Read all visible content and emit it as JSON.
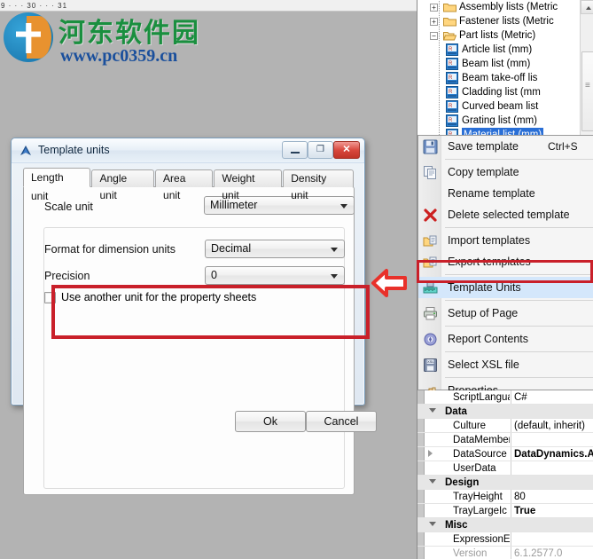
{
  "ruler": {
    "ticks": "9 · · · 30 · · · 31"
  },
  "watermark": {
    "cn_text": "河东软件园",
    "url": "www.pc0359.cn",
    "logo_icon": "circle-logo-icon"
  },
  "dialog": {
    "title": "Template units",
    "icon": "blue-triangle-icon",
    "window_buttons": {
      "minimize": "—",
      "maximize": "❐",
      "close": "✕"
    },
    "tabs": [
      {
        "label": "Length unit",
        "active": true
      },
      {
        "label": "Angle unit",
        "active": false
      },
      {
        "label": "Area unit",
        "active": false
      },
      {
        "label": "Weight unit",
        "active": false
      },
      {
        "label": "Density unit",
        "active": false
      }
    ],
    "scale_unit": {
      "label": "Scale unit",
      "value": "Millimeter"
    },
    "format_units": {
      "label": "Format for dimension units",
      "value": "Decimal"
    },
    "precision": {
      "label": "Precision",
      "value": "0"
    },
    "checkbox": {
      "label": "Use another unit for the property sheets",
      "checked": false
    },
    "buttons": {
      "ok": "Ok",
      "cancel": "Cancel"
    },
    "highlight_color": "#c9202a"
  },
  "annotation": {
    "arrow_icon": "red-left-arrow-icon",
    "color": "#e8312a"
  },
  "tree": {
    "nodes": [
      {
        "label": "Assembly lists (Metric",
        "icon": "folder-icon",
        "expander": "+",
        "depth": 0,
        "selected": false
      },
      {
        "label": "Fastener lists (Metric",
        "icon": "folder-icon",
        "expander": "+",
        "depth": 0,
        "selected": false
      },
      {
        "label": "Part lists (Metric)",
        "icon": "folder-open-icon",
        "expander": "−",
        "depth": 0,
        "selected": false
      },
      {
        "label": "Article list (mm)",
        "icon": "report-icon",
        "expander": "",
        "depth": 1,
        "selected": false
      },
      {
        "label": "Beam list (mm)",
        "icon": "report-icon",
        "expander": "",
        "depth": 1,
        "selected": false
      },
      {
        "label": "Beam take-off lis",
        "icon": "report-icon",
        "expander": "",
        "depth": 1,
        "selected": false
      },
      {
        "label": "Cladding list (mm",
        "icon": "report-icon",
        "expander": "",
        "depth": 1,
        "selected": false
      },
      {
        "label": "Curved beam list",
        "icon": "report-icon",
        "expander": "",
        "depth": 1,
        "selected": false
      },
      {
        "label": "Grating list (mm)",
        "icon": "report-icon",
        "expander": "",
        "depth": 1,
        "selected": false
      },
      {
        "label": "Material list (mm)",
        "icon": "report-icon",
        "expander": "",
        "depth": 1,
        "selected": true
      }
    ],
    "scrollbar": {
      "up_arrow": "▲",
      "thumb_grip": "≡"
    }
  },
  "context_menu": {
    "items": [
      {
        "label": "Save template",
        "accel": "Ctrl+S",
        "icon": "save-icon",
        "selected": false,
        "sep_after": true
      },
      {
        "label": "Copy template",
        "accel": "",
        "icon": "copy-icon",
        "selected": false,
        "sep_after": false
      },
      {
        "label": "Rename template",
        "accel": "",
        "icon": "",
        "selected": false,
        "sep_after": false
      },
      {
        "label": "Delete selected template",
        "accel": "",
        "icon": "delete-icon",
        "selected": false,
        "sep_after": true
      },
      {
        "label": "Import templates",
        "accel": "",
        "icon": "import-icon",
        "selected": false,
        "sep_after": false
      },
      {
        "label": "Export templates",
        "accel": "",
        "icon": "export-icon",
        "selected": false,
        "sep_after": true
      },
      {
        "label": "Template Units",
        "accel": "",
        "icon": "ruler-icon",
        "selected": true,
        "sep_after": true
      },
      {
        "label": "Setup of Page",
        "accel": "",
        "icon": "printer-icon",
        "selected": false,
        "sep_after": true
      },
      {
        "label": "Report Contents",
        "accel": "",
        "icon": "report-contents-icon",
        "selected": false,
        "sep_after": true
      },
      {
        "label": "Select XSL file",
        "accel": "",
        "icon": "disk-icon",
        "selected": false,
        "sep_after": true
      },
      {
        "label": "Properties",
        "accel": "",
        "icon": "pointer-hand-icon",
        "selected": false,
        "sep_after": false
      }
    ]
  },
  "property_grid": {
    "rows": [
      {
        "kind": "prop",
        "name": "ScriptLangua",
        "value": "C#",
        "bold": false,
        "expandable": false,
        "dim": false
      },
      {
        "kind": "cat",
        "name": "Data",
        "value": "",
        "bold": false,
        "expandable": false,
        "dim": false
      },
      {
        "kind": "prop",
        "name": "Culture",
        "value": "(default, inherit)",
        "bold": false,
        "expandable": false,
        "dim": false
      },
      {
        "kind": "prop",
        "name": "DataMember",
        "value": "",
        "bold": false,
        "expandable": false,
        "dim": false
      },
      {
        "kind": "prop",
        "name": "DataSource",
        "value": "DataDynamics.Act",
        "bold": true,
        "expandable": true,
        "dim": false
      },
      {
        "kind": "prop",
        "name": "UserData",
        "value": "",
        "bold": false,
        "expandable": false,
        "dim": false
      },
      {
        "kind": "cat",
        "name": "Design",
        "value": "",
        "bold": false,
        "expandable": false,
        "dim": false
      },
      {
        "kind": "prop",
        "name": "TrayHeight",
        "value": "80",
        "bold": false,
        "expandable": false,
        "dim": false
      },
      {
        "kind": "prop",
        "name": "TrayLargeIc",
        "value": "True",
        "bold": true,
        "expandable": false,
        "dim": false
      },
      {
        "kind": "cat",
        "name": "Misc",
        "value": "",
        "bold": false,
        "expandable": false,
        "dim": false
      },
      {
        "kind": "prop",
        "name": "ExpressionE",
        "value": "",
        "bold": false,
        "expandable": false,
        "dim": false
      },
      {
        "kind": "prop",
        "name": "Version",
        "value": "6.1.2577.0",
        "bold": false,
        "expandable": false,
        "dim": true
      }
    ]
  }
}
